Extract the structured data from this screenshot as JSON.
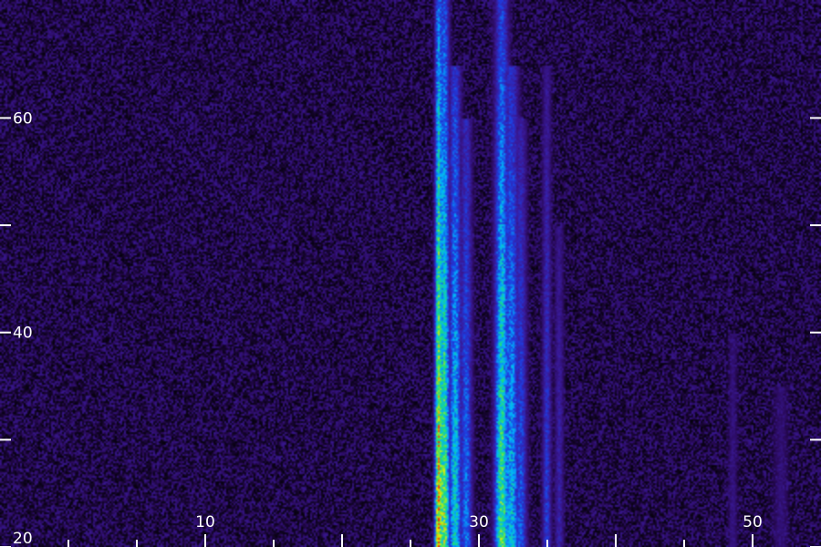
{
  "chart_data": {
    "type": "heatmap",
    "title": "",
    "xlabel": "",
    "ylabel": "",
    "xlim": [
      -5,
      55
    ],
    "ylim": [
      20,
      71
    ],
    "x_tick_labels": [
      "10",
      "30",
      "50"
    ],
    "y_tick_labels": [
      "20",
      "40",
      "60"
    ],
    "x_major_ticks": [
      10,
      20,
      30,
      40,
      50
    ],
    "x_minor_ticks": [
      0,
      5,
      15,
      25,
      35,
      45,
      50
    ],
    "y_ticks": [
      20,
      30,
      40,
      50,
      60
    ],
    "colormap": [
      "#000000",
      "#2a0a5c",
      "#3a1a9a",
      "#1e3ce0",
      "#00b4ff",
      "#20e070",
      "#e8f000",
      "#ff2000"
    ],
    "background_level": 0.18,
    "bright_lines": [
      {
        "x": 27.0,
        "intensity": 1.0,
        "spread": 0.15,
        "top": 71
      },
      {
        "x": 27.4,
        "intensity": 0.85,
        "spread": 0.25,
        "top": 71
      },
      {
        "x": 28.2,
        "intensity": 0.7,
        "spread": 0.3,
        "top": 65
      },
      {
        "x": 29.0,
        "intensity": 0.55,
        "spread": 0.3,
        "top": 60
      },
      {
        "x": 31.6,
        "intensity": 0.8,
        "spread": 0.35,
        "top": 71
      },
      {
        "x": 32.3,
        "intensity": 0.65,
        "spread": 0.4,
        "top": 65
      },
      {
        "x": 33.0,
        "intensity": 0.5,
        "spread": 0.3,
        "top": 60
      },
      {
        "x": 34.9,
        "intensity": 0.45,
        "spread": 0.2,
        "top": 65
      },
      {
        "x": 35.8,
        "intensity": 0.35,
        "spread": 0.2,
        "top": 50
      },
      {
        "x": 48.5,
        "intensity": 0.25,
        "spread": 0.2,
        "top": 40
      },
      {
        "x": 52.0,
        "intensity": 0.22,
        "spread": 0.4,
        "top": 35
      }
    ]
  }
}
